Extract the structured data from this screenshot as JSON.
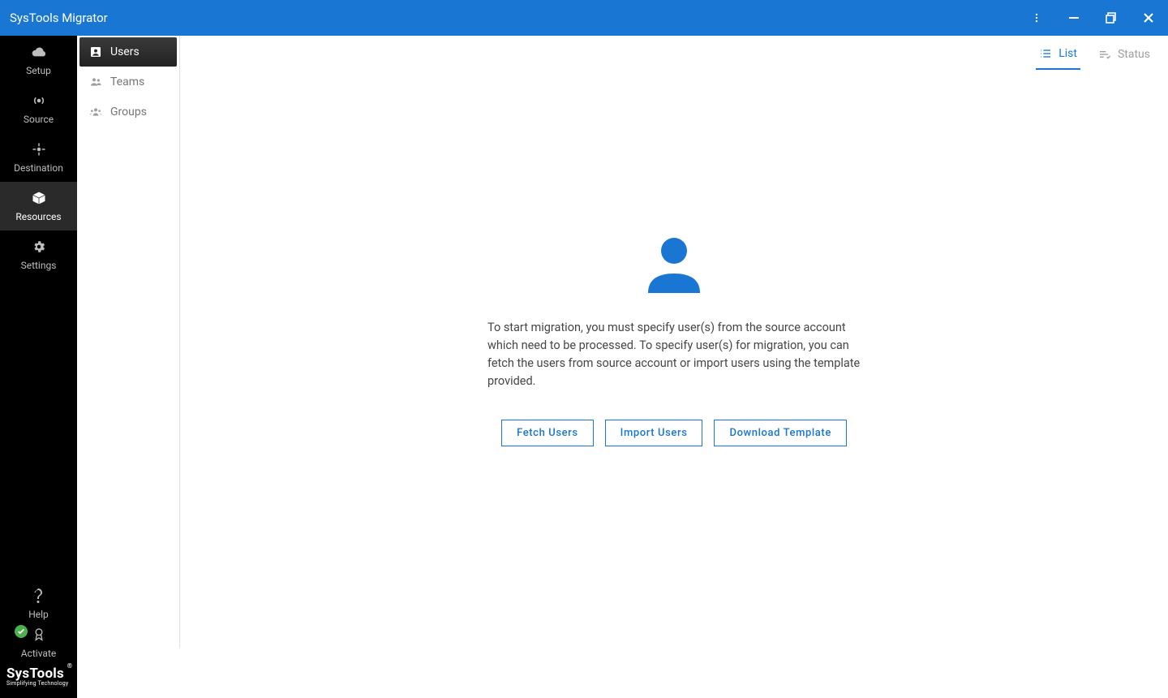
{
  "app": {
    "title": "SysTools Migrator"
  },
  "nav": {
    "items": [
      {
        "label": "Setup"
      },
      {
        "label": "Source"
      },
      {
        "label": "Destination"
      },
      {
        "label": "Resources"
      },
      {
        "label": "Settings"
      }
    ],
    "bottom": {
      "help": "Help",
      "activate": "Activate"
    },
    "logo": {
      "main": "SysTools",
      "sub": "Simplifying Technology",
      "reg": "®"
    }
  },
  "subnav": {
    "items": [
      {
        "label": "Users"
      },
      {
        "label": "Teams"
      },
      {
        "label": "Groups"
      }
    ]
  },
  "viewtabs": {
    "list": "List",
    "status": "Status"
  },
  "empty": {
    "text": "To start migration, you must specify user(s) from the source account which need to be processed. To specify user(s) for migration, you can fetch the users from source account or import users using the template provided.",
    "fetch": "Fetch Users",
    "import": "Import Users",
    "download": "Download Template"
  }
}
